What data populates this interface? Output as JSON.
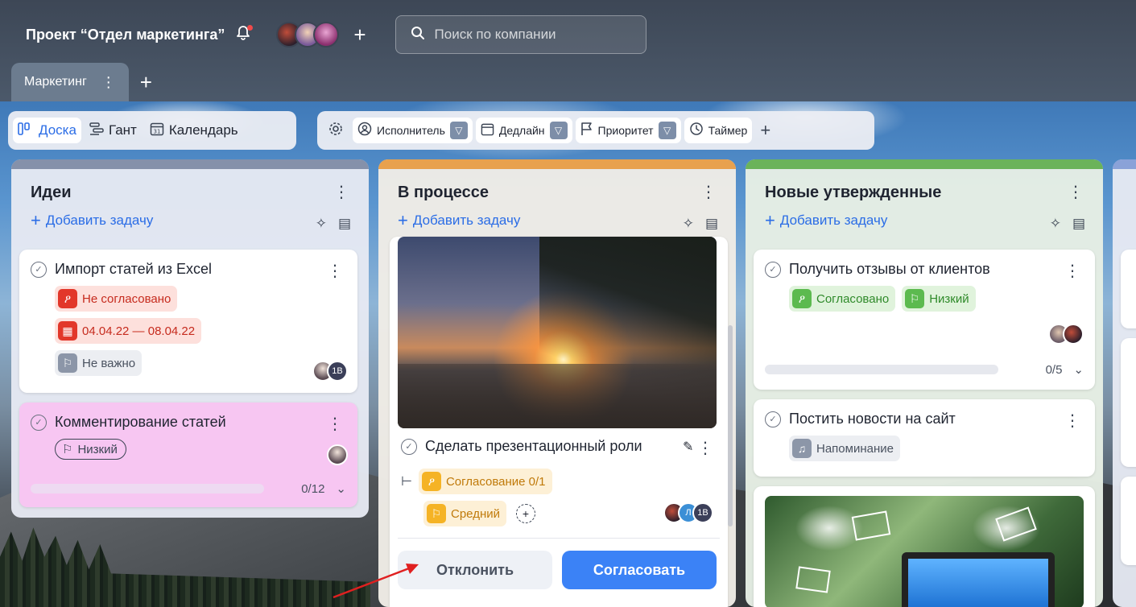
{
  "project": {
    "title": "Проект “Отдел маркетинга”",
    "search_placeholder": "Поиск по компании"
  },
  "tabs": {
    "active_label": "Маркетинг"
  },
  "views": [
    {
      "label": "Доска",
      "icon": "board-icon",
      "active": true
    },
    {
      "label": "Гант",
      "icon": "gantt-icon",
      "active": false
    },
    {
      "label": "Календарь",
      "icon": "calendar-icon",
      "active": false
    }
  ],
  "filters": [
    {
      "label": "Исполнитель",
      "icon": "person-icon"
    },
    {
      "label": "Дедлайн",
      "icon": "calendar-icon"
    },
    {
      "label": "Приоритет",
      "icon": "flag-icon"
    },
    {
      "label": "Таймер",
      "icon": "timer-icon"
    }
  ],
  "columns": {
    "ideas": {
      "title": "Идеи",
      "add_task": "Добавить задачу",
      "accent": "#7f8aa3",
      "cards": [
        {
          "title": "Импорт статей из Excel",
          "tags": [
            "Не согласовано",
            "04.04.22 — 08.04.22",
            "Не важно"
          ],
          "avatar_initials": "1В"
        },
        {
          "title": "Комментирование статей",
          "tags": [
            "Низкий"
          ],
          "progress": "0/12",
          "progress_value": 0
        }
      ]
    },
    "progress": {
      "title": "В процессе",
      "add_task": "Добавить задачу",
      "accent": "#e8a14e",
      "card": {
        "title": "Сделать презентационный роли",
        "tags": [
          "Согласование 0/1",
          "Средний"
        ],
        "avatar_initials": [
          "Л",
          "1В"
        ]
      },
      "buttons": {
        "reject": "Отклонить",
        "approve": "Согласовать"
      }
    },
    "approved": {
      "title": "Новые утвержденные",
      "add_task": "Добавить задачу",
      "accent": "#6bb35a",
      "cards": [
        {
          "title": "Получить отзывы от клиентов",
          "tags": [
            "Согласовано",
            "Низкий"
          ],
          "progress": "0/5",
          "progress_value": 0
        },
        {
          "title": "Постить новости на сайт",
          "tags": [
            "Напоминание"
          ]
        }
      ]
    }
  },
  "colors": {
    "primary": "#3b82f6",
    "danger": "#e2372a",
    "success": "#5cba4f",
    "warning": "#f5b325",
    "pink_card": "#f7c6f2"
  }
}
